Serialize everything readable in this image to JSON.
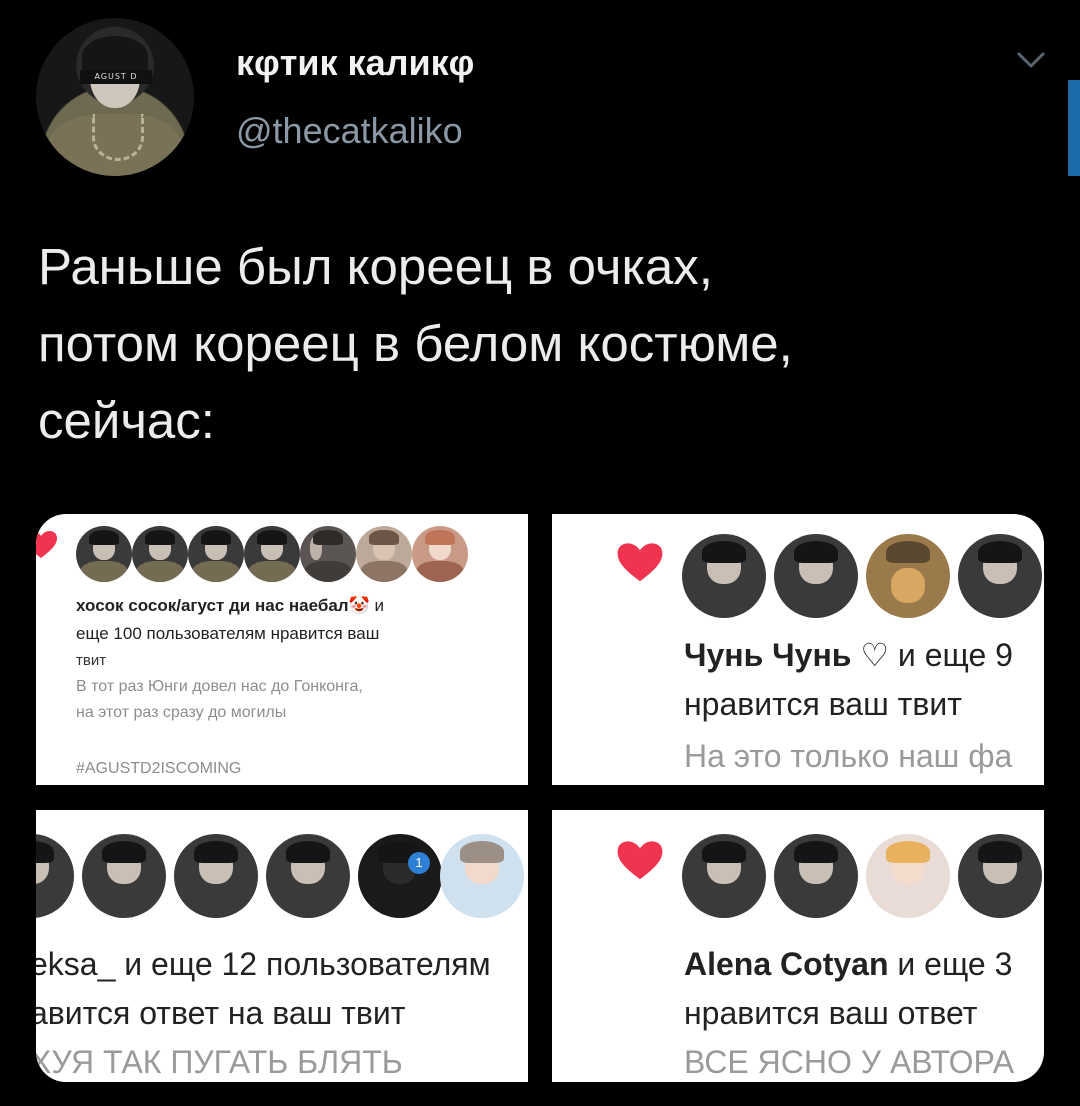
{
  "tweet": {
    "display_name": "кφтик каликφ",
    "handle": "@thecatkaliko",
    "avatar_text": "AGUST D",
    "text_lines": [
      "Раньше был кореец в очках,",
      "потом кореец в белом костюме,",
      "сейчас:"
    ]
  },
  "screenshots": [
    {
      "name_part": "хосок сосок/агуст ди нас наебал",
      "emoji": "🤡",
      "name_suffix": " и",
      "line2": "еще 100 пользователям нравится ваш",
      "line3": "твит",
      "line4": "В тот раз Юнги довел нас до Гонконга,",
      "line5": "на этот раз сразу до могилы",
      "line6": "#AGUSTD2ISCOMING"
    },
    {
      "name_part": "Чунь Чунь ♡",
      "name_suffix": " и еще 9",
      "line2": "нравится ваш твит",
      "line3": "На это только наш фа"
    },
    {
      "name_part": "eksa_",
      "name_suffix": " и еще 12 пользователям",
      "line2": "авится ответ на ваш твит",
      "line3": "ХУЯ ТАК ПУГАТЬ БЛЯТЬ",
      "badge": "1"
    },
    {
      "name_part": "Alena Cotyan",
      "name_suffix": " и еще 3",
      "line2": "нравится ваш ответ",
      "line3": "ВСЕ ЯСНО У АВТОРА"
    }
  ],
  "colors": {
    "background": "#000000",
    "text": "#e7e9ea",
    "handle": "#8b98a5",
    "heart": "#f0344f",
    "accent": "#1d6aa8"
  }
}
